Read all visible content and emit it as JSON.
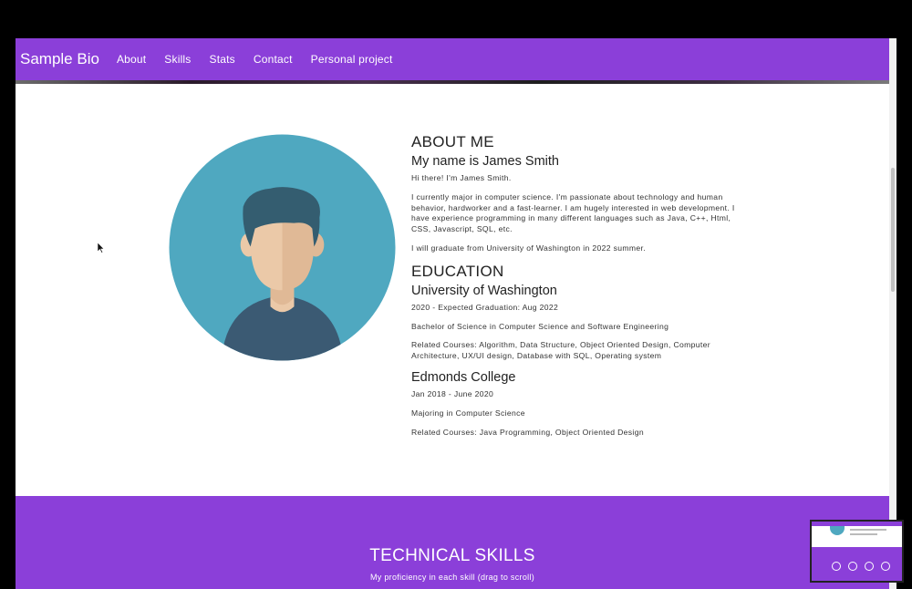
{
  "navbar": {
    "brand": "Sample Bio",
    "links": [
      "About",
      "Skills",
      "Stats",
      "Contact",
      "Personal project"
    ]
  },
  "about": {
    "heading": "ABOUT ME",
    "name_heading": "My name is James Smith",
    "intro": "Hi there! I'm James Smith.",
    "bio": "I currently major in computer science. I'm passionate about technology and human behavior, hardworker and a fast-learner. I am hugely interested in web development. I have experience programming in many different languages such as Java, C++, Html, CSS, Javascript, SQL, etc.",
    "graduation": "I will graduate from University of Washington in 2022 summer."
  },
  "education": {
    "heading": "EDUCATION",
    "schools": [
      {
        "name": "University of Washington",
        "dates": "2020 - Expected Graduation: Aug 2022",
        "degree": "Bachelor of Science in Computer Science and Software Engineering",
        "courses": "Related Courses: Algorithm, Data Structure, Object Oriented Design, Computer Architecture, UX/UI design, Database with SQL, Operating system"
      },
      {
        "name": "Edmonds College",
        "dates": "Jan 2018 - June 2020",
        "degree": "Majoring in Computer Science",
        "courses": "Related Courses: Java Programming, Object Oriented Design"
      }
    ]
  },
  "skills": {
    "title": "TECHNICAL SKILLS",
    "subtitle": "My proficiency in each skill (drag to scroll)"
  },
  "colors": {
    "brand_purple": "#8b3fd9",
    "avatar_bg": "#4fa8c0",
    "hair": "#345d70",
    "skin": "#ebc9a8",
    "shirt": "#3b5a73"
  },
  "icons": {
    "avatar": "person-avatar-icon",
    "cursor": "mouse-pointer-icon"
  }
}
